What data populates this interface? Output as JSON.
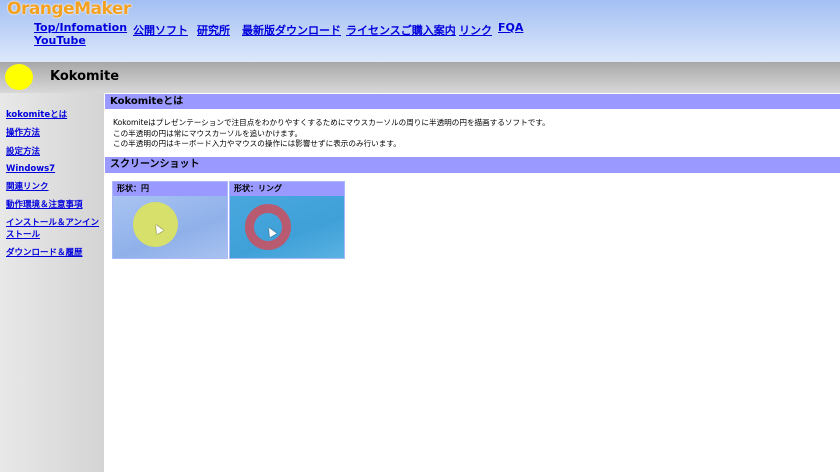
{
  "header": {
    "logo": "OrangeMaker",
    "nav": [
      "Top/Infomation",
      "YouTube",
      "公開ソフト",
      "研究所",
      "最新版ダウンロード",
      "ライセンスご購入案内",
      "リンク",
      "FQA"
    ]
  },
  "page": {
    "title": "Kokomite"
  },
  "sidebar": {
    "items": [
      "kokomiteとは",
      "操作方法",
      "設定方法",
      "Windows7",
      "関連リンク",
      "動作環境＆注意事項",
      "インストール＆アンインストール",
      "ダウンロード＆履歴"
    ]
  },
  "main": {
    "section1": {
      "title": "Kokomiteとは",
      "lines": [
        "Kokomiteはプレゼンテーションで注目点をわかりやすくするためにマウスカーソルの周りに半透明の円を描画するソフトです。",
        "この半透明の円は常にマウスカーソルを追いかけます。",
        "この半透明の円はキーボード入力やマウスの操作には影響せずに表示のみ行います。"
      ]
    },
    "section2": {
      "title": "スクリーンショット",
      "cards": [
        {
          "caption": "形状：円"
        },
        {
          "caption": "形状：リング"
        }
      ]
    }
  },
  "colors": {
    "section": "#9999ff",
    "link": "#0000dd",
    "logo": "#f4a020",
    "dot": "#ffff00"
  }
}
